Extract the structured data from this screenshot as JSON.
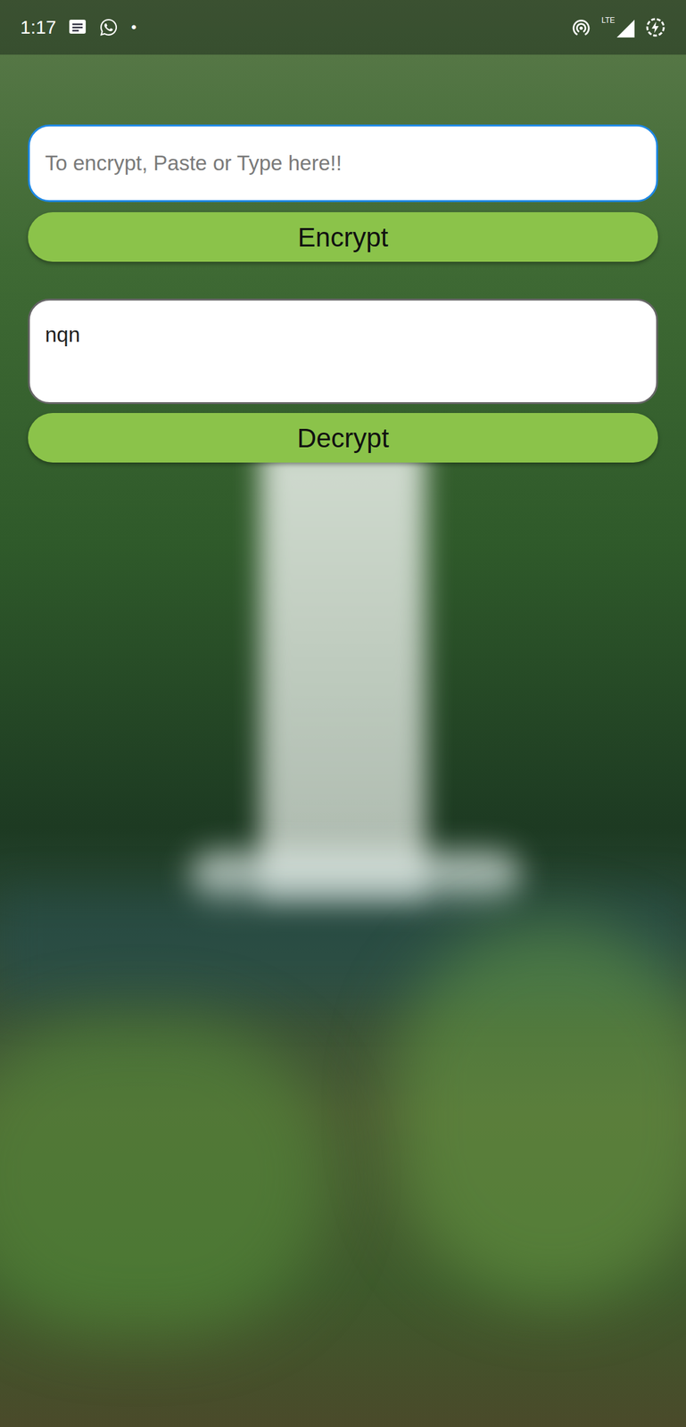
{
  "status_bar": {
    "time": "1:17",
    "dot": "•",
    "network": "LTE"
  },
  "encrypt": {
    "placeholder": "To encrypt, Paste or Type here!!",
    "value": "",
    "focused": true,
    "button": "Encrypt"
  },
  "decrypt": {
    "placeholder": "",
    "value": "nqn",
    "focused": false,
    "button": "Decrypt"
  }
}
